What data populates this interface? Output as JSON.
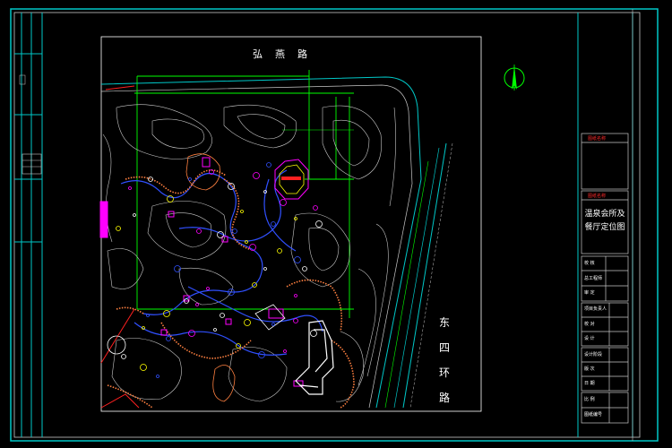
{
  "road_top": "弘燕路",
  "road_right": "东四环路",
  "title_block": {
    "box1_header": "图纸名称",
    "box2_header": "图纸名称",
    "drawing_title_line1": "温泉会所及",
    "drawing_title_line2": "餐厅定位图",
    "rows_group1": [
      "校 核",
      "总工程师",
      "审 定"
    ],
    "rows_group2": [
      "项目负责人",
      "校 对",
      "设 计"
    ],
    "rows_group3": [
      "设计阶段",
      "版 次",
      "日 期"
    ],
    "rows_group4": [
      "比 例",
      "图纸编号"
    ]
  },
  "colors": {
    "frame": "#00c8c8",
    "contour": "#c8c8c8",
    "grid": "#00ff00",
    "path_blue": "#3050ff",
    "magenta": "#ff00ff",
    "red": "#ff2020",
    "yellow": "#ffff00",
    "orange": "#ff8040",
    "compass": "#00ff00"
  },
  "icons": {
    "north_arrow": "north-arrow-icon"
  }
}
